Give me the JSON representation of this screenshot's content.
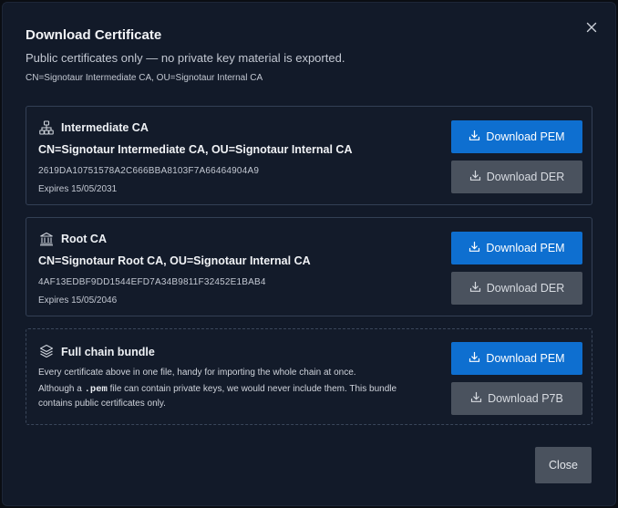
{
  "dialog": {
    "title": "Download Certificate",
    "subtitle": "Public certificates only — no private key material is exported.",
    "distinguished_name": "CN=Signotaur Intermediate CA, OU=Signotaur Internal CA",
    "close_icon": "close-icon",
    "footer_close_label": "Close"
  },
  "certificates": [
    {
      "icon": "hierarchy-icon",
      "name": "Intermediate CA",
      "subject": "CN=Signotaur Intermediate CA, OU=Signotaur Internal CA",
      "serial": "2619DA10751578A2C666BBA8103F7A66464904A9",
      "expiry": "Expires 15/05/2031",
      "primary_label": "Download PEM",
      "secondary_label": "Download DER"
    },
    {
      "icon": "bank-icon",
      "name": "Root CA",
      "subject": "CN=Signotaur Root CA, OU=Signotaur Internal CA",
      "serial": "4AF13EDBF9DD1544EFD7A34B9811F32452E1BAB4",
      "expiry": "Expires 15/05/2046",
      "primary_label": "Download PEM",
      "secondary_label": "Download DER"
    }
  ],
  "bundle": {
    "icon": "layers-icon",
    "name": "Full chain bundle",
    "description_1": "Every certificate above in one file, handy for importing the whole chain at once.",
    "description_2_pre": "Although a ",
    "description_2_code": ".pem",
    "description_2_post": " file can contain private keys, we would never include them. This bundle contains public certificates only.",
    "primary_label": "Download PEM",
    "secondary_label": "Download P7B"
  },
  "colors": {
    "primary_button": "#0e6fd0",
    "secondary_button": "#4a525e",
    "modal_background": "#121a29"
  }
}
